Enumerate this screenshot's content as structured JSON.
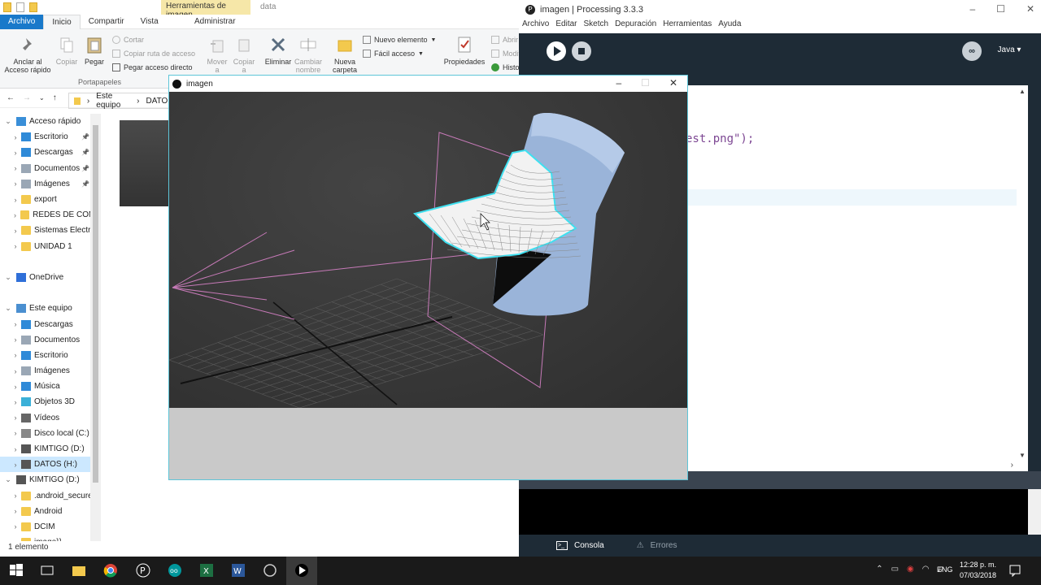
{
  "explorer": {
    "context_tab": "Herramientas de imagen",
    "window_title": "data",
    "tabs": [
      "Archivo",
      "Inicio",
      "Compartir",
      "Vista",
      "Administrar"
    ],
    "ribbon": {
      "pin_quick_access": "Anclar al Acceso rápido",
      "copy": "Copiar",
      "paste": "Pegar",
      "cut": "Cortar",
      "copy_path": "Copiar ruta de acceso",
      "paste_shortcut": "Pegar acceso directo",
      "clipboard_group": "Portapapeles",
      "move_to": "Mover a",
      "copy_to": "Copiar a",
      "delete": "Eliminar",
      "rename": "Cambiar nombre",
      "new_folder": "Nueva carpeta",
      "new_item": "Nuevo elemento",
      "easy_access": "Fácil acceso",
      "properties": "Propiedades",
      "open": "Abrir",
      "modify": "Modif",
      "history": "Histo"
    },
    "address": {
      "pc": "Este equipo",
      "drive": "DATOS"
    },
    "nav": [
      {
        "label": "Acceso rápido",
        "level": 0,
        "pin": false
      },
      {
        "label": "Escritorio",
        "level": 1,
        "pin": true
      },
      {
        "label": "Descargas",
        "level": 1,
        "pin": true
      },
      {
        "label": "Documentos",
        "level": 1,
        "pin": true
      },
      {
        "label": "Imágenes",
        "level": 1,
        "pin": true
      },
      {
        "label": "export",
        "level": 1,
        "pin": false
      },
      {
        "label": "REDES DE COMP",
        "level": 1,
        "pin": false
      },
      {
        "label": "Sistemas Electro",
        "level": 1,
        "pin": false
      },
      {
        "label": "UNIDAD 1",
        "level": 1,
        "pin": false
      },
      {
        "label": "",
        "level": 0,
        "pin": false
      },
      {
        "label": "OneDrive",
        "level": 0,
        "pin": false
      },
      {
        "label": "",
        "level": 0,
        "pin": false
      },
      {
        "label": "Este equipo",
        "level": 0,
        "pin": false
      },
      {
        "label": "Descargas",
        "level": 1,
        "pin": false
      },
      {
        "label": "Documentos",
        "level": 1,
        "pin": false
      },
      {
        "label": "Escritorio",
        "level": 1,
        "pin": false
      },
      {
        "label": "Imágenes",
        "level": 1,
        "pin": false
      },
      {
        "label": "Música",
        "level": 1,
        "pin": false
      },
      {
        "label": "Objetos 3D",
        "level": 1,
        "pin": false
      },
      {
        "label": "Vídeos",
        "level": 1,
        "pin": false
      },
      {
        "label": "Disco local (C:)",
        "level": 1,
        "pin": false
      },
      {
        "label": "KIMTIGO (D:)",
        "level": 1,
        "pin": false
      },
      {
        "label": "DATOS (H:)",
        "level": 1,
        "pin": false,
        "selected": true
      },
      {
        "label": "KIMTIGO (D:)",
        "level": 0,
        "pin": false
      },
      {
        "label": ".android_secure",
        "level": 1,
        "pin": false
      },
      {
        "label": "Android",
        "level": 1,
        "pin": false
      },
      {
        "label": "DCIM",
        "level": 1,
        "pin": false
      },
      {
        "label": "image}}",
        "level": 1,
        "pin": false
      }
    ],
    "status": "1 elemento"
  },
  "ide": {
    "title": "imagen | Processing 3.3.3",
    "menu": [
      "Archivo",
      "Editar",
      "Sketch",
      "Depuración",
      "Herramientas",
      "Ayuda"
    ],
    "mode": "Java",
    "code_visible": "est.png\");",
    "footer": {
      "console": "Consola",
      "errors": "Errores"
    }
  },
  "sketch": {
    "title": "imagen"
  },
  "taskbar": {
    "language": "ENG",
    "time": "12:28 p. m.",
    "date": "07/03/2018"
  }
}
